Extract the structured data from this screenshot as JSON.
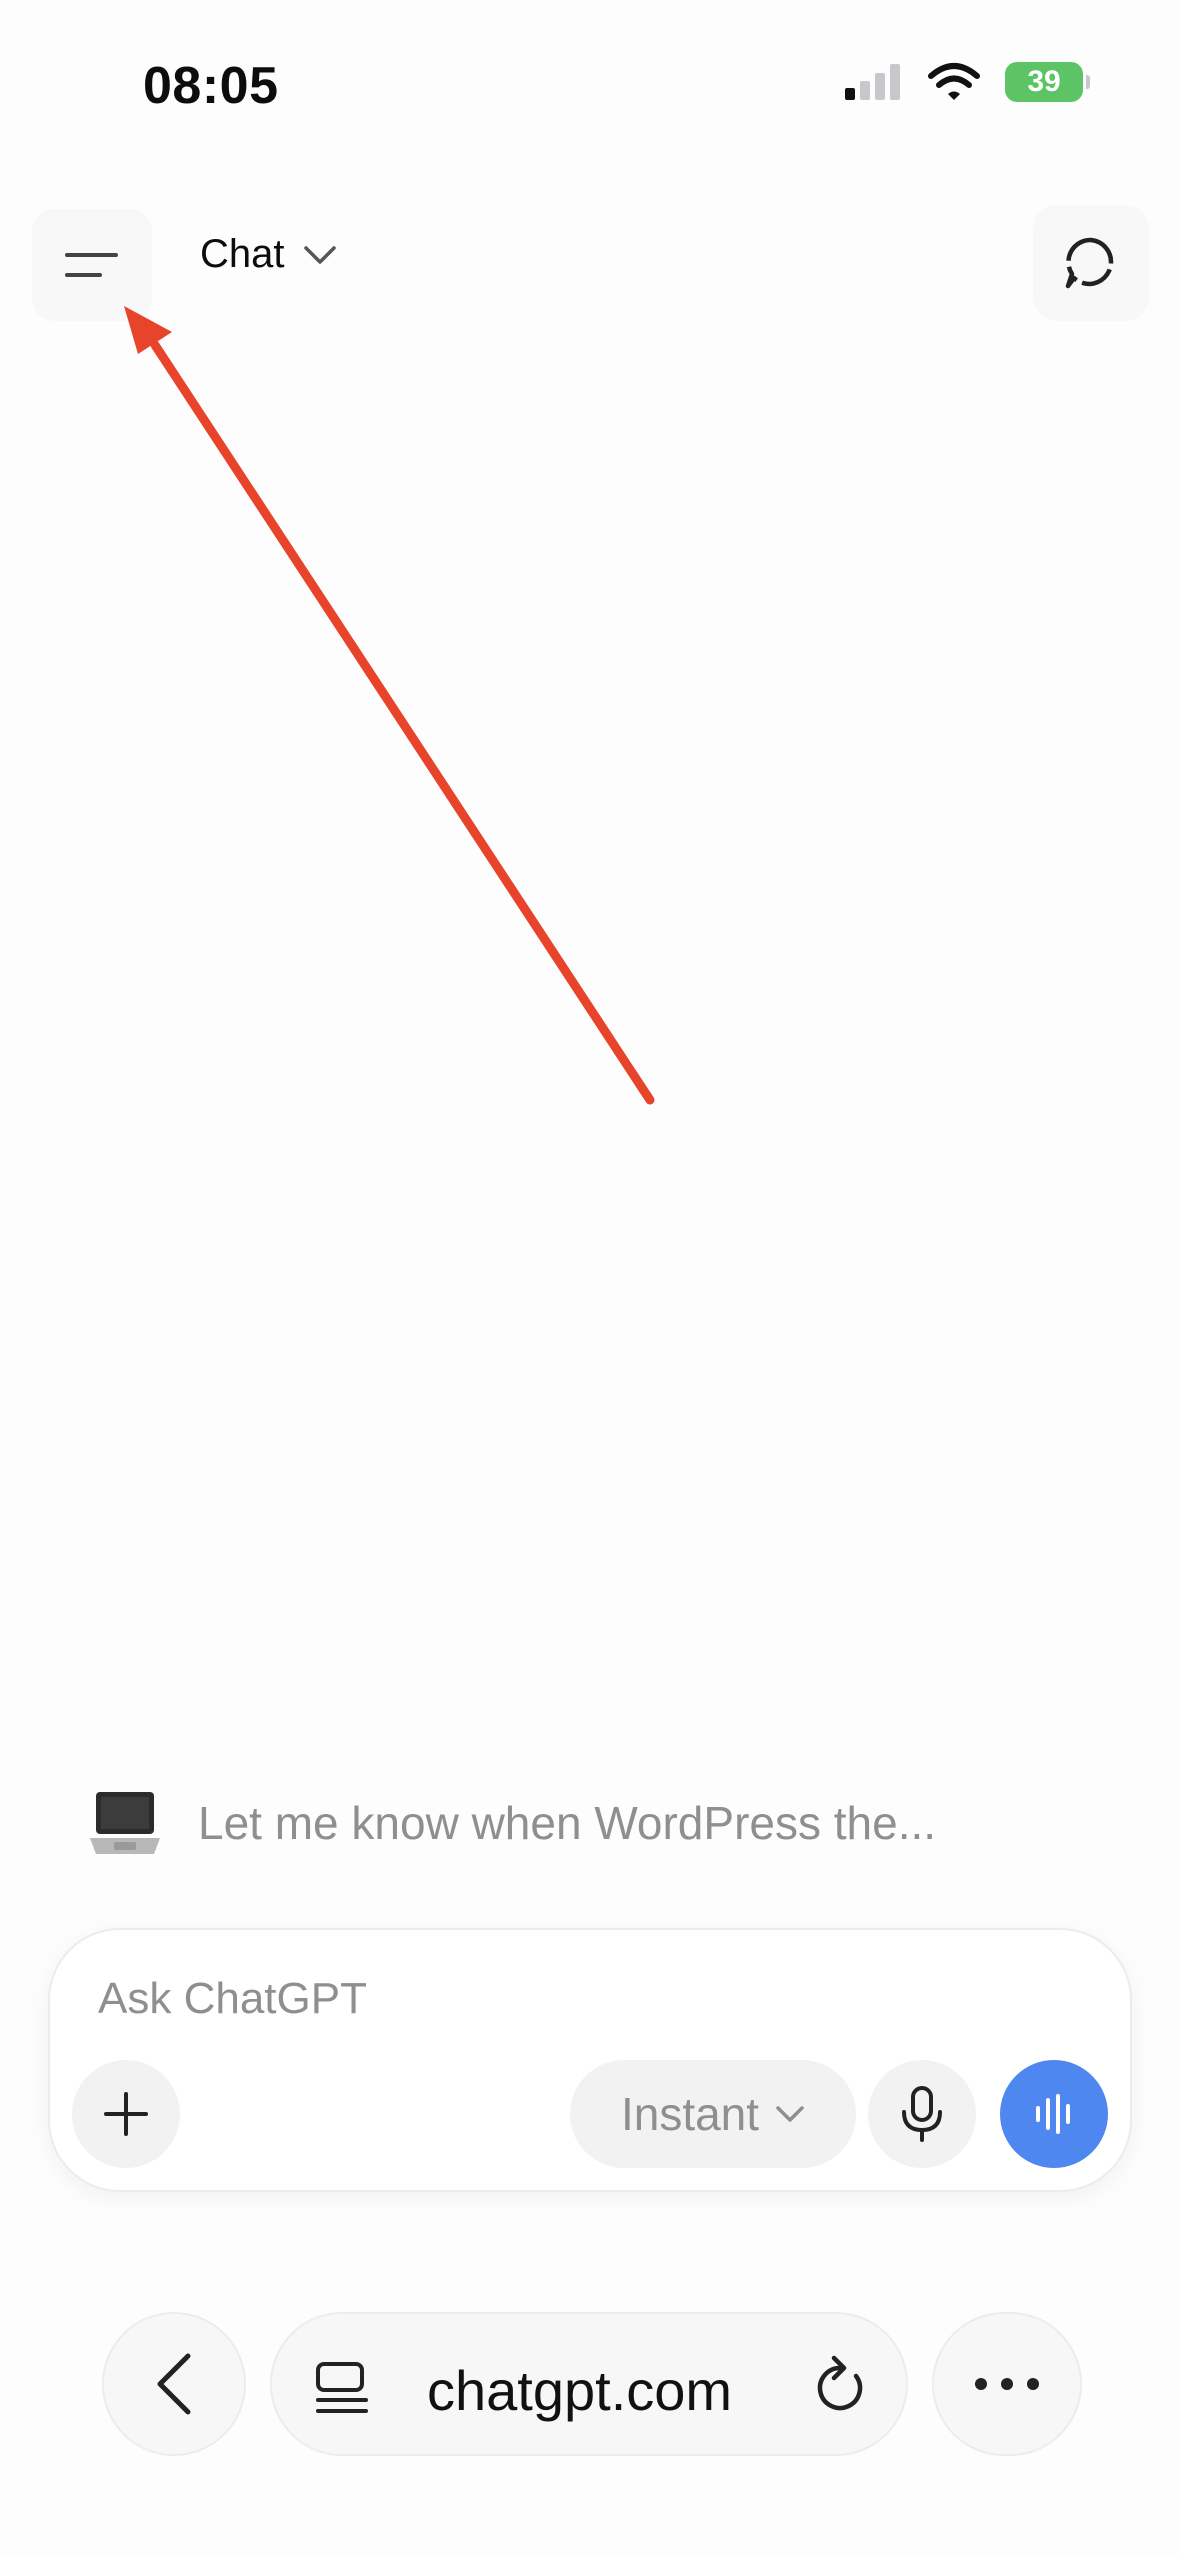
{
  "status_bar": {
    "time": "08:05",
    "battery": "39"
  },
  "header": {
    "model_label": "Chat"
  },
  "suggestion": {
    "emoji": "💻",
    "text": "Let me know when WordPress the..."
  },
  "composer": {
    "placeholder": "Ask ChatGPT",
    "mode_label": "Instant"
  },
  "browser": {
    "url": "chatgpt.com"
  },
  "colors": {
    "accent_blue": "#4f87f0",
    "annotation_red": "#e8432b",
    "battery_green": "#5dc466"
  },
  "icons": {
    "menu": "menu-icon",
    "new_chat": "new-chat-icon",
    "plus": "plus-icon",
    "mic": "mic-icon",
    "voice": "voice-wave-icon",
    "back": "chevron-left-icon",
    "tabs": "tabs-icon",
    "reload": "reload-icon",
    "more": "ellipsis-icon"
  }
}
